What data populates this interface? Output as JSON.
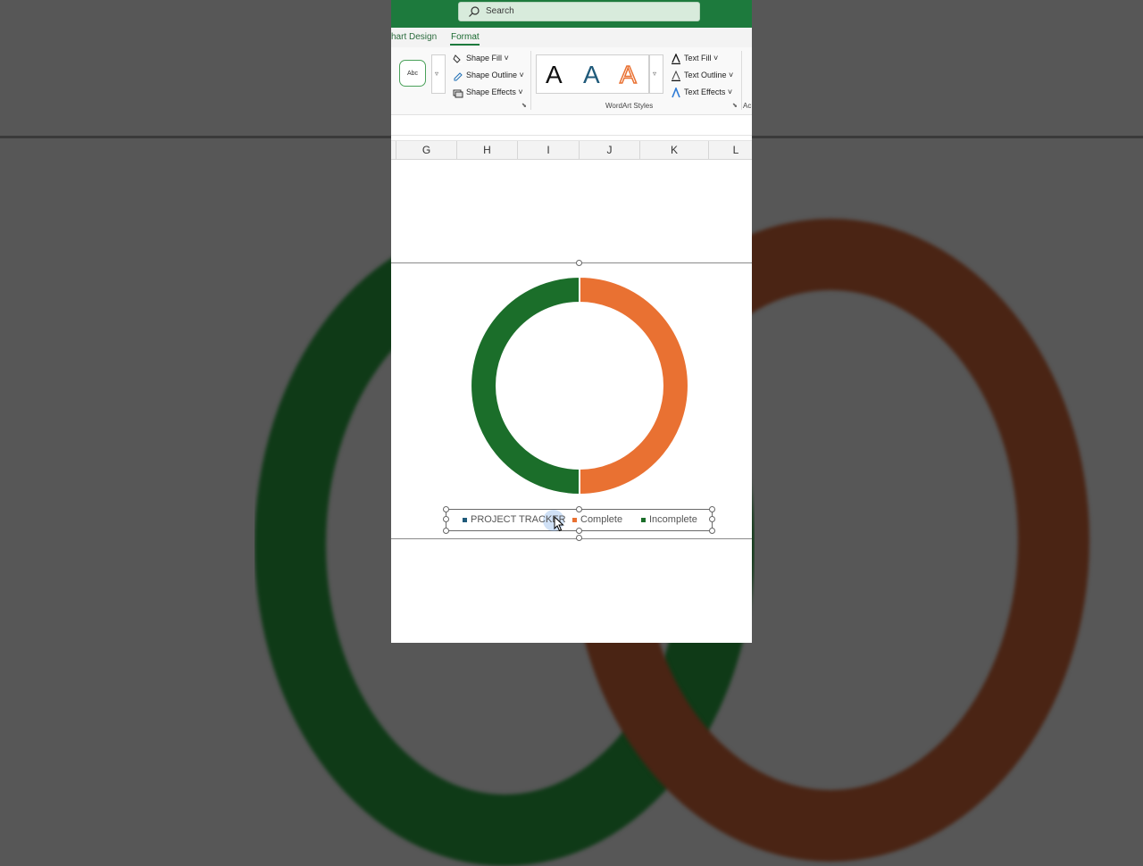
{
  "search": {
    "placeholder": "Search"
  },
  "tabs": [
    {
      "label": "hart Design"
    },
    {
      "label": "Format",
      "active": true
    }
  ],
  "ribbon": {
    "shape_style_sample": "Abc",
    "shape_fill": "Shape Fill",
    "shape_outline": "Shape Outline",
    "shape_effects": "Shape Effects",
    "wordart_samples": [
      "A",
      "A",
      "A"
    ],
    "text_fill": "Text Fill",
    "text_outline": "Text Outline",
    "text_effects": "Text Effects",
    "wordart_group_label": "WordArt Styles",
    "next_group_label_partial": "Ac"
  },
  "columns": [
    "G",
    "H",
    "I",
    "J",
    "K",
    "L"
  ],
  "chart_data": {
    "type": "pie",
    "variant": "donut",
    "slices": [
      {
        "name": "Complete",
        "value": 50,
        "color": "#e97132"
      },
      {
        "name": "Incomplete",
        "value": 50,
        "color": "#1b6e2a"
      }
    ],
    "legend": [
      {
        "name": "PROJECT TRACKER",
        "color": "#1f5a7a"
      },
      {
        "name": "Complete",
        "color": "#e97132"
      },
      {
        "name": "Incomplete",
        "color": "#1b6e2a"
      }
    ],
    "legend_position": "bottom"
  },
  "colors": {
    "excel_green": "#1d7a3d",
    "complete": "#e97132",
    "incomplete": "#1b6e2a"
  }
}
